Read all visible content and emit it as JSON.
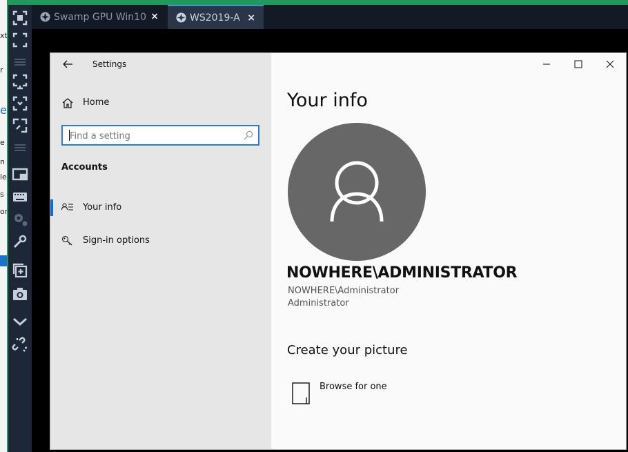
{
  "tabs": [
    {
      "label": "Swamp GPU Win10",
      "close": "×"
    },
    {
      "label": "WS2019-A",
      "close": "×"
    }
  ],
  "window": {
    "title": "Settings",
    "minimize": "—",
    "maximize": "☐",
    "close": "✕"
  },
  "nav": {
    "home_label": "Home",
    "search_placeholder": "Find a setting",
    "section_title": "Accounts",
    "items": [
      {
        "label": "Your info",
        "icon": "person-list-icon",
        "selected": true
      },
      {
        "label": "Sign-in options",
        "icon": "key-icon",
        "selected": false
      }
    ]
  },
  "main": {
    "heading": "Your info",
    "username": "NOWHERE\\ADMINISTRATOR",
    "account_name": "NOWHERE\\Administrator",
    "role": "Administrator",
    "create_heading": "Create your picture",
    "browse_label": "Browse for one"
  },
  "colors": {
    "accent": "#0a6cd6",
    "toolbar_bg": "#1e2738",
    "tabbar_bg": "#131a26",
    "avatar_bg": "#676767",
    "green_border": "#1f9a5a"
  },
  "toolbar_icons": [
    "fullscreen-icon",
    "expand-icon",
    "divider-icon",
    "fit-screen-icon",
    "fit-window-icon",
    "resize-icon",
    "divider-icon",
    "monitor-icon",
    "keyboard-icon",
    "settings-gear-icon",
    "wrench-icon",
    "add-window-icon",
    "camera-icon",
    "chevron-down-icon",
    "link-icon"
  ]
}
